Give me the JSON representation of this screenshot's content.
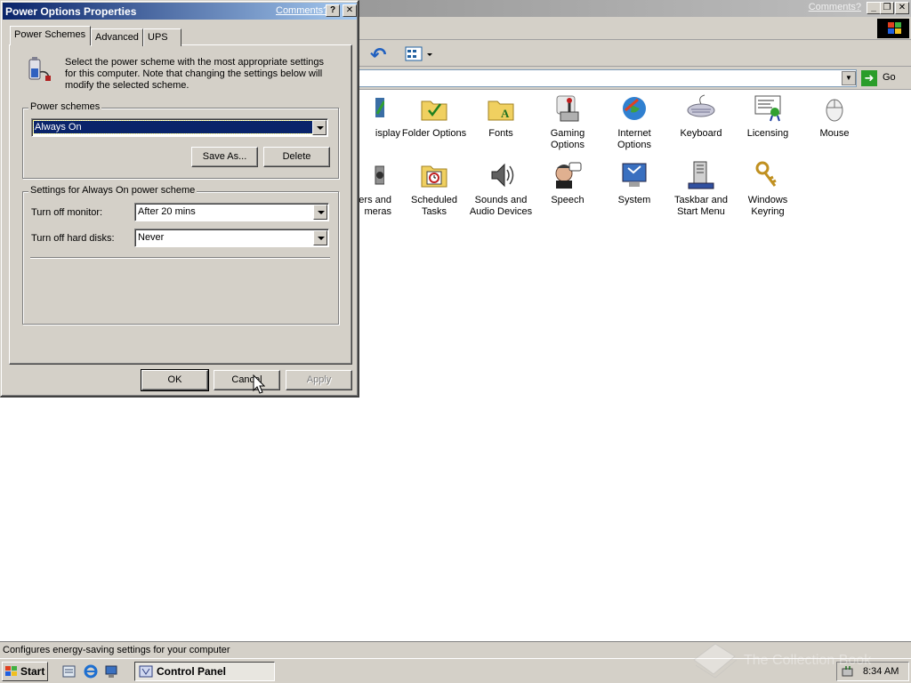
{
  "control_panel": {
    "comments_link": "Comments?",
    "go_label": "Go",
    "status_text": "Configures energy-saving settings for your computer",
    "items": [
      {
        "label": "isplay",
        "icon": "display-icon"
      },
      {
        "label": "Folder Options",
        "icon": "folder-options-icon"
      },
      {
        "label": "Fonts",
        "icon": "fonts-icon"
      },
      {
        "label": "Gaming Options",
        "icon": "gaming-options-icon"
      },
      {
        "label": "Internet Options",
        "icon": "internet-options-icon"
      },
      {
        "label": "Keyboard",
        "icon": "keyboard-icon"
      },
      {
        "label": "Licensing",
        "icon": "licensing-icon"
      },
      {
        "label": "Mouse",
        "icon": "mouse-icon"
      },
      {
        "label": "nners and meras",
        "icon": "scanners-cameras-icon"
      },
      {
        "label": "Scheduled Tasks",
        "icon": "scheduled-tasks-icon"
      },
      {
        "label": "Sounds and Audio Devices",
        "icon": "sounds-icon"
      },
      {
        "label": "Speech",
        "icon": "speech-icon"
      },
      {
        "label": "System",
        "icon": "system-icon"
      },
      {
        "label": "Taskbar and Start Menu",
        "icon": "taskbar-icon"
      },
      {
        "label": "Windows Keyring",
        "icon": "keyring-icon"
      }
    ]
  },
  "dialog": {
    "title": "Power Options Properties",
    "comments_link": "Comments?",
    "help_label": "?",
    "close_label": "✕",
    "tabs": [
      "Power Schemes",
      "Advanced",
      "UPS"
    ],
    "intro_text": "Select the power scheme with the most appropriate settings for this computer. Note that changing the settings below will modify the selected scheme.",
    "schemes_group_label": "Power schemes",
    "selected_scheme": "Always On",
    "save_as_label": "Save As...",
    "delete_label": "Delete",
    "settings_group_label": "Settings for Always On power scheme",
    "monitor_label": "Turn off monitor:",
    "monitor_value": "After 20 mins",
    "disks_label": "Turn off hard disks:",
    "disks_value": "Never",
    "ok_label": "OK",
    "cancel_label": "Cancel",
    "apply_label": "Apply"
  },
  "taskbar": {
    "start_label": "Start",
    "task_label": "Control Panel",
    "clock": "8:34 AM"
  },
  "watermark": {
    "text": "The Collection Book"
  },
  "colors": {
    "title_active": "#0a246a",
    "title_inactive": "#808080",
    "face": "#d4d0c8",
    "selection": "#0a246a"
  }
}
